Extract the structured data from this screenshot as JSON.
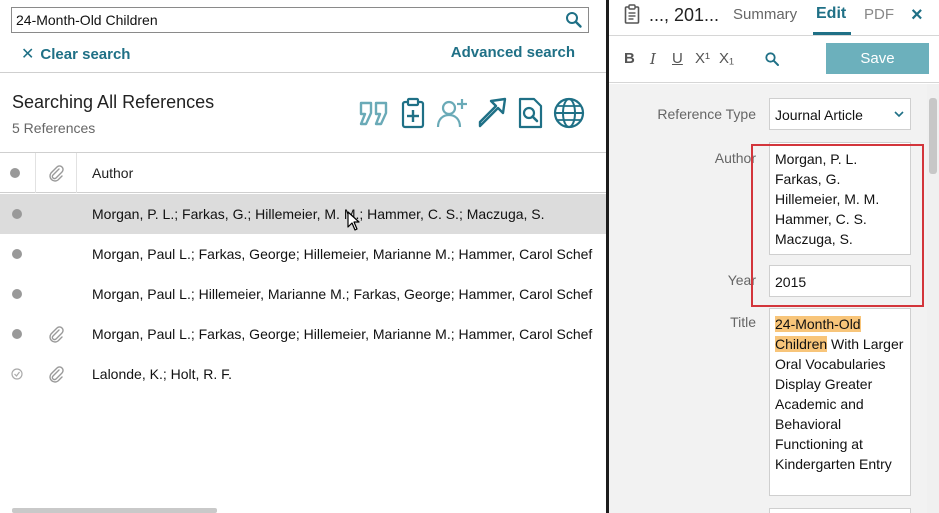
{
  "search": {
    "query": "24-Month-Old Children",
    "clear_label": "Clear search",
    "advanced_label": "Advanced search"
  },
  "list": {
    "group_title": "Searching All References",
    "count": "5 References",
    "column_author": "Author",
    "toolbar_icons": [
      "quote-icon",
      "clipboard-add-icon",
      "add-user-icon",
      "share-arrow-icon",
      "search-document-icon",
      "globe-icon"
    ],
    "rows": [
      {
        "author": "Morgan, P. L.; Farkas, G.; Hillemeier, M. M.; Hammer, C. S.; Maczuga, S.",
        "attachment": false,
        "read": false,
        "selected": true
      },
      {
        "author": "Morgan, Paul L.; Farkas, George; Hillemeier, Marianne M.; Hammer, Carol Schef",
        "attachment": false,
        "read": false,
        "selected": false
      },
      {
        "author": "Morgan, Paul L.; Hillemeier, Marianne M.; Farkas, George; Hammer, Carol Schef",
        "attachment": false,
        "read": false,
        "selected": false
      },
      {
        "author": "Morgan, Paul L.; Farkas, George; Hillemeier, Marianne M.; Hammer, Carol Schef",
        "attachment": true,
        "read": false,
        "selected": false
      },
      {
        "author": "Lalonde, K.; Holt, R. F.",
        "attachment": true,
        "read": true,
        "selected": false
      }
    ]
  },
  "panel": {
    "ref_short": "..., 201...",
    "tab_summary": "Summary",
    "tab_edit": "Edit",
    "tab_pdf": "PDF",
    "close": "×",
    "format": {
      "bold": "B",
      "italic": "I",
      "underline": "U",
      "superscript": "X¹",
      "subscript": "X₁"
    },
    "save_label": "Save",
    "reference_type_label": "Reference Type",
    "reference_type_value": "Journal Article",
    "author_label": "Author",
    "authors": [
      "Morgan, P. L.",
      "Farkas, G.",
      "Hillemeier, M. M.",
      "Hammer, C. S.",
      "Maczuga, S."
    ],
    "year_label": "Year",
    "year_value": "2015",
    "title_label": "Title",
    "title_highlight": "24-Month-Old Children",
    "title_rest": " With Larger Oral Vocabularies Display Greater Academic and Behavioral Functioning at Kindergarten Entry"
  },
  "colors": {
    "accent": "#1f7086",
    "save_button": "#6cb0bc",
    "highlight_border": "#d3353b",
    "search_highlight": "#f8c57a",
    "selected_row": "#dcdcdc"
  }
}
